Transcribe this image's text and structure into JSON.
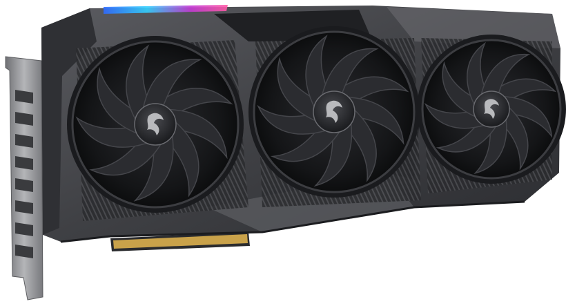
{
  "scene": {
    "subject": "graphics-card",
    "fan_count": 3,
    "background_color": "#ffffff",
    "shroud_color": "#4a4b4f",
    "shroud_dark_color": "#222326",
    "fan_blade_color": "#1e1f22",
    "rgb_strip_colors": [
      "#2f6bff",
      "#c53bd6",
      "#ff5aa5",
      "#34d1ff"
    ],
    "pcie_contact_color": "#c9a24a",
    "bracket_color": "#9a9b9e"
  },
  "logos": {
    "fan_hub_emblem": "dragon-emblem"
  }
}
